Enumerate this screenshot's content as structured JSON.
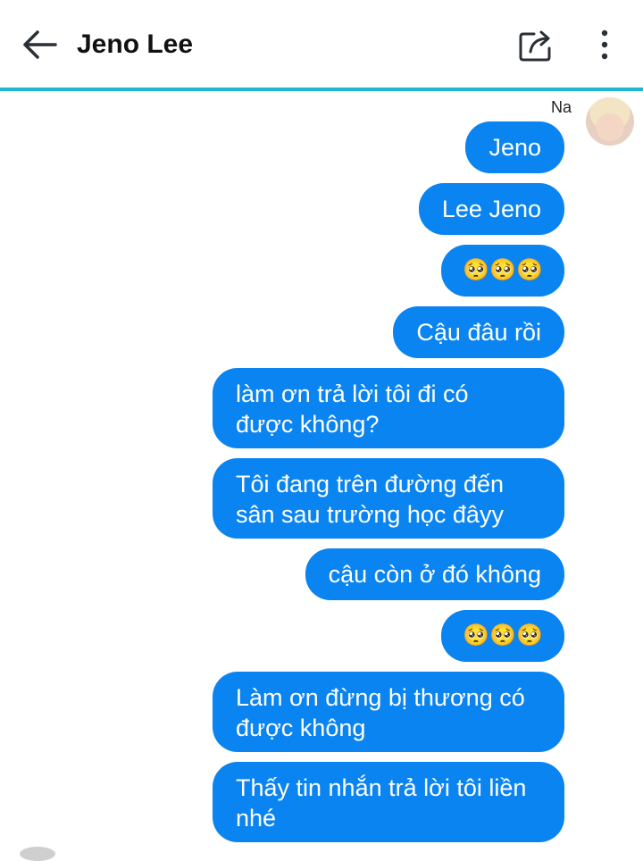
{
  "header": {
    "title": "Jeno Lee",
    "back_icon": "arrow-left-icon",
    "share_icon": "share-icon",
    "more_icon": "more-vert-icon",
    "accent": "#1fb6d6"
  },
  "conversation": {
    "sender_name": "Na",
    "bubble_color": "#0a84f0",
    "messages": [
      "Jeno",
      "Lee Jeno",
      "🥺🥺🥺",
      "Cậu đâu rồi",
      "làm ơn trả lời tôi đi có\nđược không?",
      "Tôi đang trên đường đến\nsân sau trường học đâyy",
      "cậu còn ở đó không",
      "🥺🥺🥺",
      "Làm ơn đừng bị thương có\nđược không",
      "Thấy tin nhắn trả lời tôi liền\nnhé"
    ]
  }
}
